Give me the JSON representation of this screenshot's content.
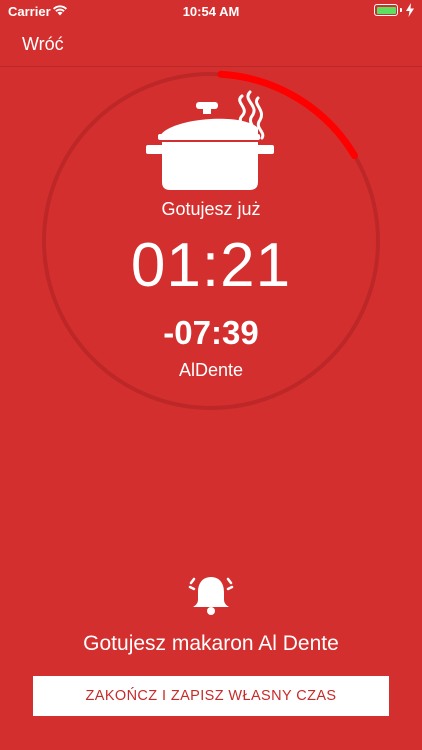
{
  "status_bar": {
    "carrier": "Carrier",
    "time": "10:54 AM",
    "icons": [
      "wifi-icon",
      "battery-icon",
      "charging-icon"
    ]
  },
  "nav": {
    "back_label": "Wróć"
  },
  "timer": {
    "cooking_label": "Gotujesz już",
    "elapsed": "01:21",
    "remaining": "-07:39",
    "doneness": "AlDente",
    "progress_fraction": 0.155,
    "icon": "pot-icon"
  },
  "alert": {
    "icon": "bell-icon",
    "message": "Gotujesz makaron Al Dente"
  },
  "action": {
    "finish_label": "ZAKOŃCZ I ZAPISZ WŁASNY CZAS"
  },
  "colors": {
    "background": "#d42f2f",
    "ring_track": "#be2727",
    "ring_progress": "#ff0000",
    "button_text": "#c62b2b"
  }
}
